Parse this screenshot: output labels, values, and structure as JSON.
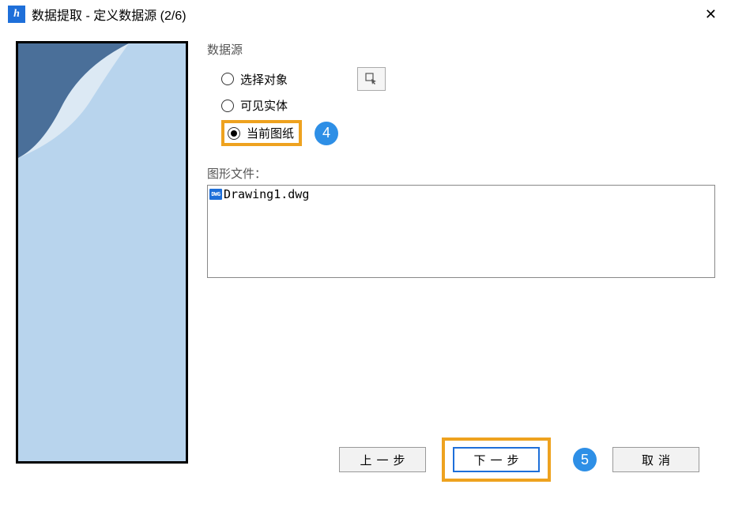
{
  "titlebar": {
    "app_icon_text": "h",
    "title": "数据提取 - 定义数据源 (2/6)"
  },
  "data_source": {
    "group_label": "数据源",
    "option_select_objects": "选择对象",
    "option_visible_entities": "可见实体",
    "option_current_drawing": "当前图纸"
  },
  "callouts": {
    "step4": "4",
    "step5": "5"
  },
  "files": {
    "label": "图形文件：",
    "items": [
      "Drawing1.dwg"
    ],
    "icon_text": "DWG"
  },
  "buttons": {
    "prev": "上一步",
    "next": "下一步",
    "cancel": "取消"
  }
}
